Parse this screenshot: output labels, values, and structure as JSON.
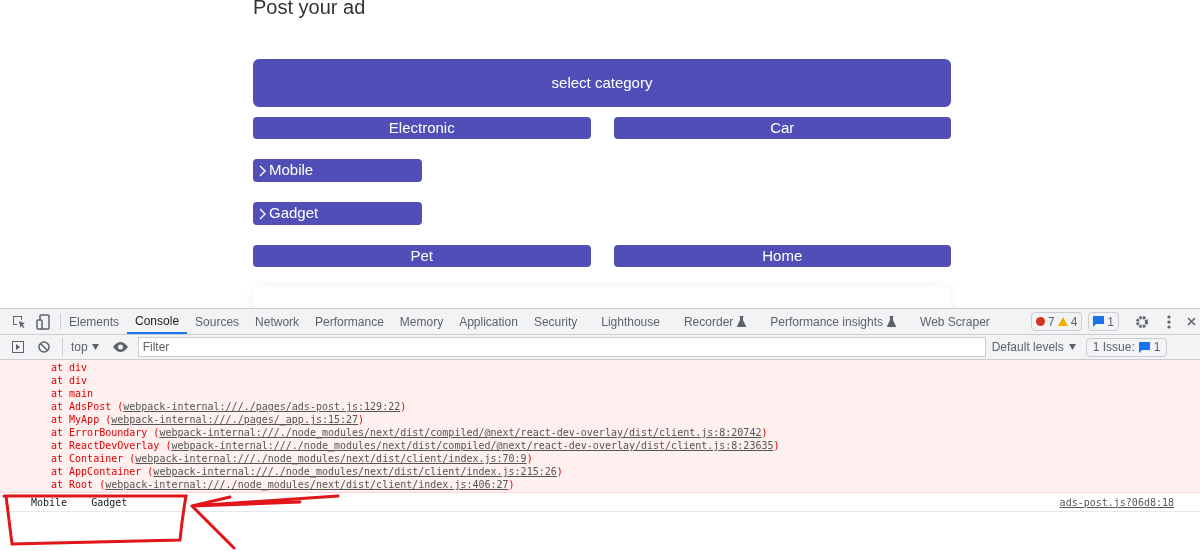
{
  "page": {
    "title": "Post your ad",
    "select_button": "select category",
    "categories": [
      {
        "label": "Electronic",
        "children": [
          {
            "label": "Mobile"
          },
          {
            "label": "Gadget"
          }
        ]
      },
      {
        "label": "Car"
      },
      {
        "label": "Pet"
      },
      {
        "label": "Home"
      }
    ]
  },
  "devtools": {
    "tabs": [
      {
        "label": "Elements",
        "selected": false,
        "experimental": false
      },
      {
        "label": "Console",
        "selected": true,
        "experimental": false
      },
      {
        "label": "Sources",
        "selected": false,
        "experimental": false
      },
      {
        "label": "Network",
        "selected": false,
        "experimental": false
      },
      {
        "label": "Performance",
        "selected": false,
        "experimental": false
      },
      {
        "label": "Memory",
        "selected": false,
        "experimental": false
      },
      {
        "label": "Application",
        "selected": false,
        "experimental": false
      },
      {
        "label": "Security",
        "selected": false,
        "experimental": false
      },
      {
        "label": "Lighthouse",
        "selected": false,
        "experimental": false
      },
      {
        "label": "Recorder",
        "selected": false,
        "experimental": true
      },
      {
        "label": "Performance insights",
        "selected": false,
        "experimental": true
      },
      {
        "label": "Web Scraper",
        "selected": false,
        "experimental": false
      }
    ],
    "errors": "7",
    "warnings": "4",
    "messages": "1",
    "context": "top",
    "filter_placeholder": "Filter",
    "levels": "Default levels",
    "issues_label": "1 Issue:",
    "issues_count": "1",
    "error_lines": [
      {
        "text": "at div"
      },
      {
        "text": "at div"
      },
      {
        "text": "at main"
      },
      {
        "text": "at AdsPost (",
        "link": "webpack-internal:///./pages/ads-post.js:129:22",
        "close": ")"
      },
      {
        "text": "at MyApp (",
        "link": "webpack-internal:///./pages/_app.js:15:27",
        "close": ")"
      },
      {
        "text": "at ErrorBoundary (",
        "link": "webpack-internal:///./node_modules/next/dist/compiled/@next/react-dev-overlay/dist/client.js:8:20742",
        "close": ")"
      },
      {
        "text": "at ReactDevOverlay (",
        "link": "webpack-internal:///./node_modules/next/dist/compiled/@next/react-dev-overlay/dist/client.js:8:23635",
        "close": ")"
      },
      {
        "text": "at Container (",
        "link": "webpack-internal:///./node_modules/next/dist/client/index.js:70:9",
        "close": ")"
      },
      {
        "text": "at AppContainer (",
        "link": "webpack-internal:///./node_modules/next/dist/client/index.js:215:26",
        "close": ")"
      },
      {
        "text": "at Root (",
        "link": "webpack-internal:///./node_modules/next/dist/client/index.js:406:27",
        "close": ")"
      }
    ],
    "log_message": "Mobile    Gadget",
    "log_source": "ads-post.js?06d8:18"
  }
}
